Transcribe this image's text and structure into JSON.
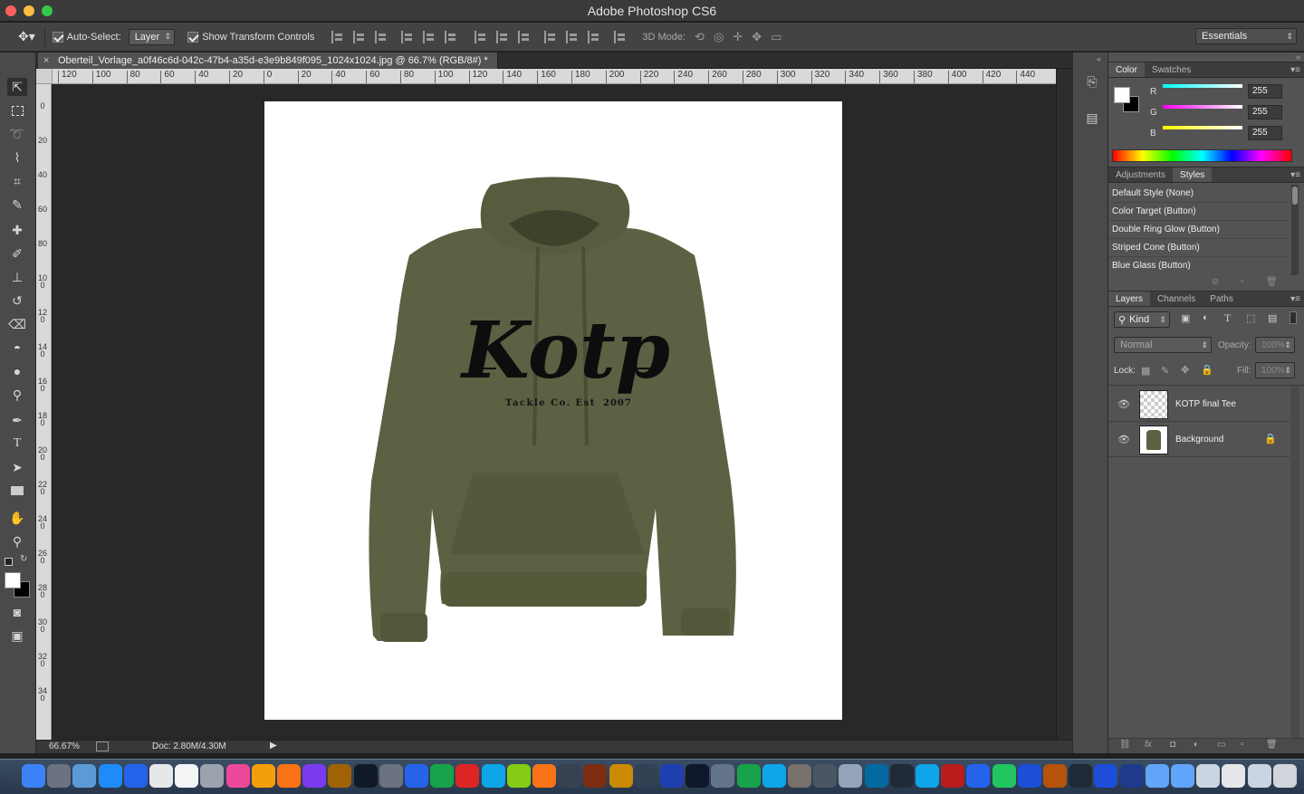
{
  "app": {
    "title": "Adobe Photoshop CS6"
  },
  "options": {
    "auto_select_label": "Auto-Select:",
    "auto_select_value": "Layer",
    "show_transform_label": "Show Transform Controls",
    "mode_3d_label": "3D Mode:",
    "workspace": "Essentials"
  },
  "document": {
    "tab_title": "Oberteil_Vorlage_a0f46c6d-042c-47b4-a35d-e3e9b849f095_1024x1024.jpg @ 66.7% (RGB/8#) *",
    "logo_text": "Kotp",
    "logo_sub_left": "Tackle Co. Est",
    "logo_sub_right": "2007",
    "hoodie_color": "#5a5d40"
  },
  "ruler": {
    "h_labels": [
      "120",
      "100",
      "80",
      "60",
      "40",
      "20",
      "0",
      "20",
      "40",
      "60",
      "80",
      "100",
      "120",
      "140",
      "160",
      "180",
      "200",
      "220",
      "240",
      "260",
      "280",
      "300",
      "320",
      "340",
      "360",
      "380",
      "400",
      "420",
      "440"
    ],
    "v_labels": [
      "0",
      "20",
      "40",
      "60",
      "80",
      "100",
      "120",
      "140",
      "160",
      "180",
      "200",
      "220",
      "240",
      "260",
      "280",
      "300",
      "320",
      "340"
    ]
  },
  "status": {
    "zoom": "66.67%",
    "doc": "Doc: 2.80M/4.30M"
  },
  "color_panel": {
    "tabs": [
      "Color",
      "Swatches"
    ],
    "r_label": "R",
    "g_label": "G",
    "b_label": "B",
    "r": "255",
    "g": "255",
    "b": "255"
  },
  "styles_panel": {
    "tabs": [
      "Adjustments",
      "Styles"
    ],
    "items": [
      "Default Style (None)",
      "Color Target (Button)",
      "Double Ring Glow (Button)",
      "Striped Cone (Button)",
      "Blue Glass (Button)"
    ]
  },
  "layers_panel": {
    "tabs": [
      "Layers",
      "Channels",
      "Paths"
    ],
    "filter": "Kind",
    "blend_mode": "Normal",
    "opacity_label": "Opacity:",
    "opacity": "100%",
    "lock_label": "Lock:",
    "fill_label": "Fill:",
    "fill": "100%",
    "layers": [
      {
        "name": "KOTP final Tee"
      },
      {
        "name": "Background"
      }
    ]
  }
}
